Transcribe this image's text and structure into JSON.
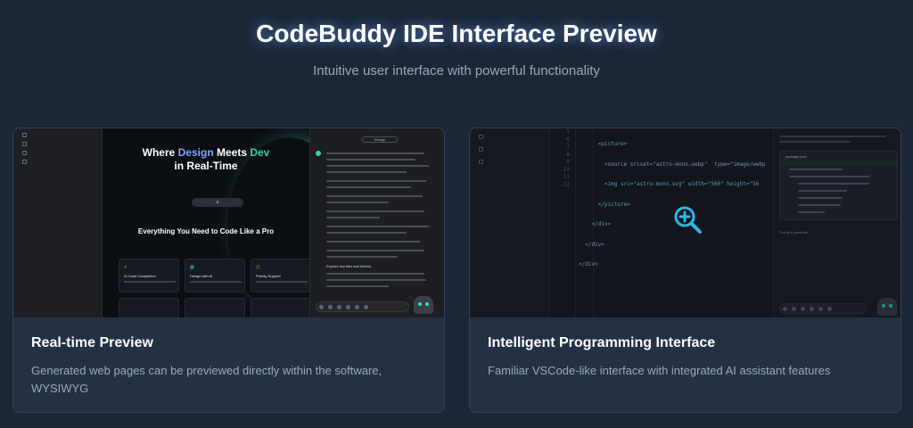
{
  "page": {
    "title": "CodeBuddy IDE Interface Preview",
    "subtitle": "Intuitive user interface with powerful functionality"
  },
  "cards": [
    {
      "title": "Real-time Preview",
      "description": "Generated web pages can be previewed directly within the software, WYSIWYG",
      "preview": {
        "hero_prefix": "Where ",
        "hero_design": "Design",
        "hero_middle": " Meets ",
        "hero_dev": "Dev",
        "hero_line2": "in Real-Time",
        "section_title": "Everything You Need to Code Like a Pro",
        "features": [
          {
            "title": "AI Code Completion",
            "icon": "lightning-icon"
          },
          {
            "title": "Design with AI",
            "icon": "grid-icon"
          },
          {
            "title": "Priority Support",
            "icon": "badge-icon"
          }
        ],
        "chat_button": "Design",
        "chat_file_label": "Explore key files and folders."
      }
    },
    {
      "title": "Intelligent Programming Interface",
      "description": "Familiar VSCode-like interface with integrated AI assistant features",
      "editor": {
        "line_numbers": [
          "5",
          "6",
          "7",
          "8",
          "9",
          "10",
          "11",
          "12"
        ],
        "code_lines": [
          "      <picture>",
          "        <source srcset=\"astro-mono.webp\"  type=\"image/webp",
          "        <img src=\"astro-mono.svg\" width=\"560\" height=\"56",
          "      </picture>",
          "    </div>",
          "  </div>",
          "</div>",
          ""
        ],
        "chat_file": "package.json",
        "chat_status": "Trying to generate ..."
      }
    }
  ],
  "colors": {
    "accent_blue": "#7ca8ff",
    "accent_green": "#38d39f",
    "zoom_icon": "#2fb8e8"
  }
}
